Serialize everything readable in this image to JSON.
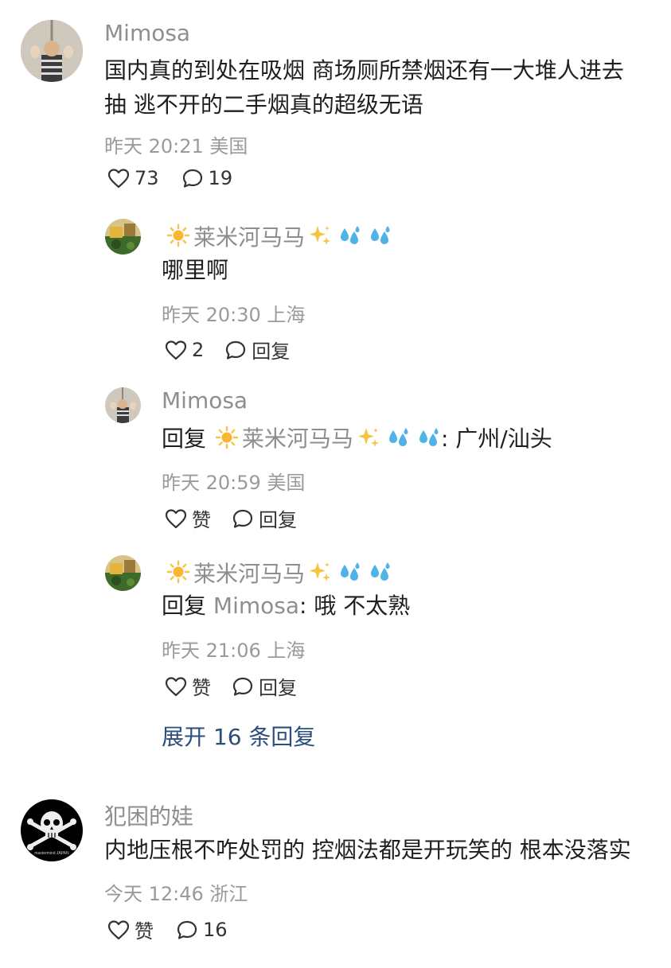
{
  "comments": [
    {
      "author": "Mimosa",
      "text_line1": "国内真的到处在吸烟 商场厕所禁烟还有一大堆人进去",
      "text_line2": "抽 逃不开的二手烟真的超级无语",
      "meta": "昨天 20:21 美国",
      "likes": "73",
      "replies": "19",
      "sub_replies": [
        {
          "author": "莱米河马马",
          "text": "哪里啊",
          "meta": "昨天 20:30 上海",
          "likes": "2",
          "reply_label": "回复"
        },
        {
          "author": "Mimosa",
          "reply_prefix": "回复",
          "reply_to": "莱米河马马",
          "text": ": 广州/汕头",
          "meta": "昨天 20:59 美国",
          "likes": "赞",
          "reply_label": "回复"
        },
        {
          "author": "莱米河马马",
          "reply_prefix": "回复",
          "reply_to": "Mimosa",
          "text": ": 哦 不太熟",
          "meta": "昨天 21:06 上海",
          "likes": "赞",
          "reply_label": "回复"
        }
      ],
      "expand_label": "展开 16 条回复"
    },
    {
      "author": "犯困的娃",
      "text_line1": "内地压根不咋处罚的 控烟法都是开玩笑的 根本没落实",
      "meta": "今天 12:46 浙江",
      "likes": "赞",
      "replies": "16",
      "avatar_caption": "mastermind JAPAN"
    }
  ],
  "icons": {
    "like": "heart-outline-icon",
    "reply": "speech-bubble-icon",
    "name_emoji_prefix": "sun-emoji",
    "name_emoji_suffix": "sparkles-emoji",
    "name_emoji_drops": "sweat-droplets-emoji"
  },
  "colors": {
    "name": "#8e8e8e",
    "meta": "#9a9a9a",
    "link": "#2a4f7d",
    "emoji_sun": "#f5c542",
    "emoji_drops": "#4fb3e8"
  }
}
